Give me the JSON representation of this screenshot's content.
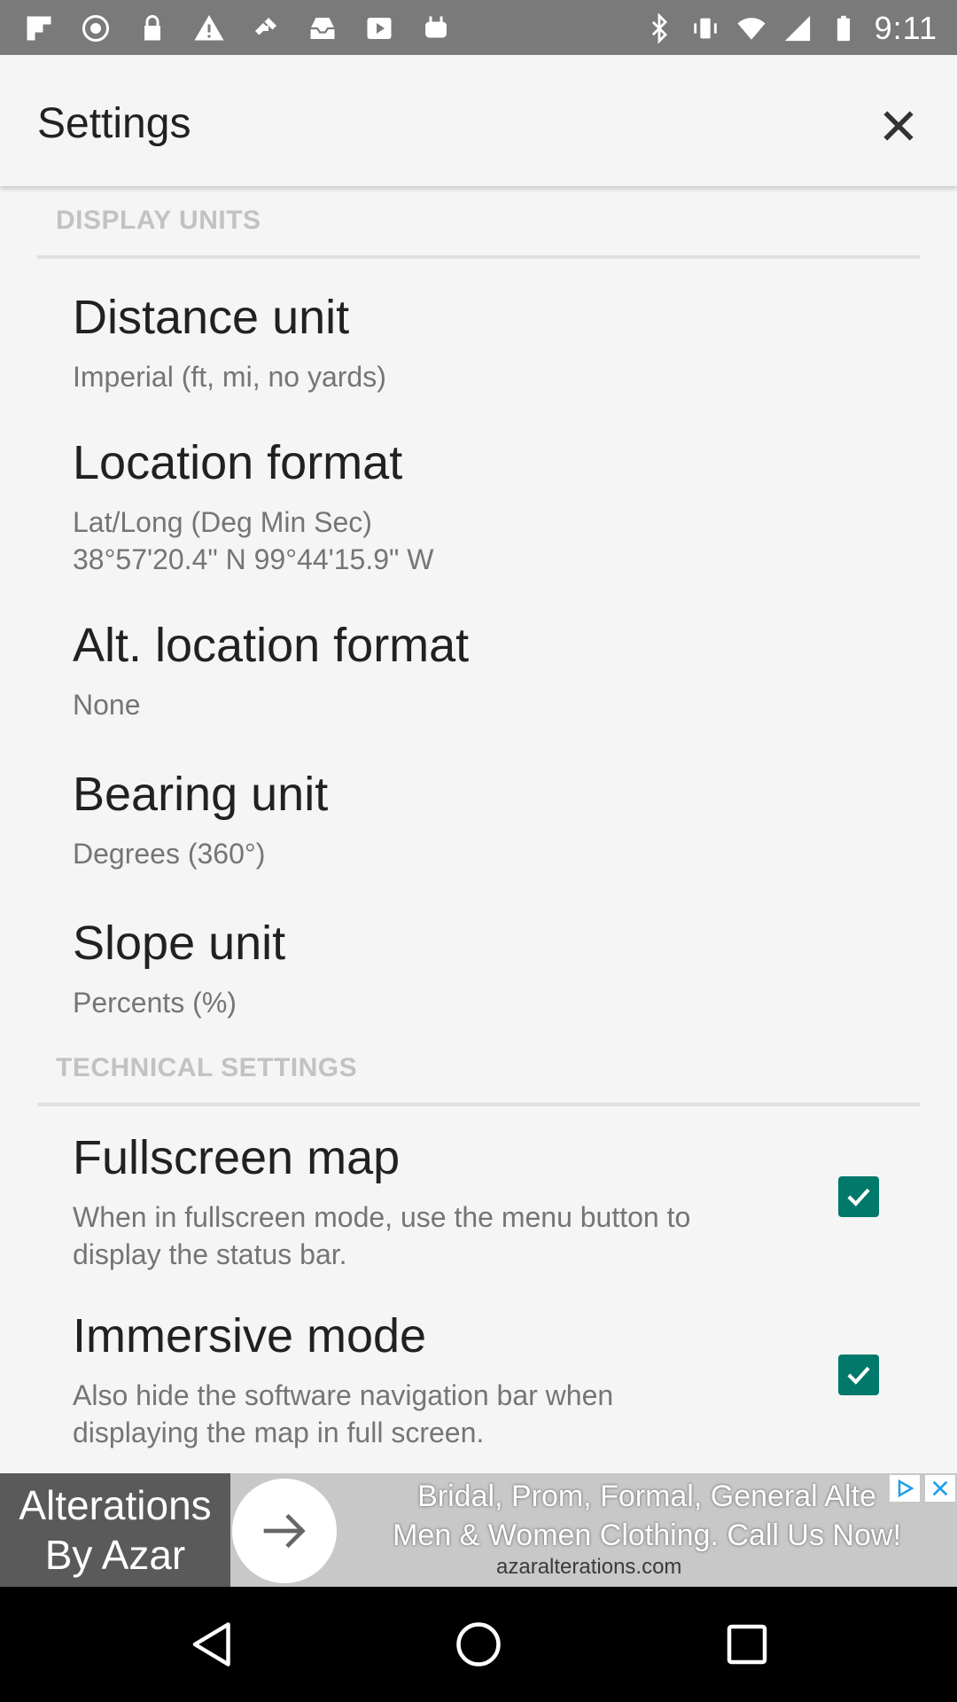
{
  "status_bar": {
    "time": "9:11",
    "left_icons": [
      "flipboard-icon",
      "pocket-icon",
      "lock-icon",
      "warning-icon",
      "fake-gps-icon",
      "inbox-icon",
      "video-icon",
      "android-icon"
    ],
    "right_icons": [
      "bluetooth-icon",
      "vibrate-icon",
      "wifi-icon",
      "signal-icon",
      "battery-icon"
    ]
  },
  "app_bar": {
    "title": "Settings"
  },
  "sections": [
    {
      "header": "DISPLAY UNITS",
      "items": [
        {
          "title": "Distance unit",
          "summary": [
            "Imperial (ft, mi, no yards)"
          ]
        },
        {
          "title": "Location format",
          "summary": [
            "Lat/Long (Deg Min Sec)",
            "38°57'20.4\" N 99°44'15.9\" W"
          ]
        },
        {
          "title": "Alt. location format",
          "summary": [
            "None"
          ]
        },
        {
          "title": "Bearing unit",
          "summary": [
            "Degrees (360°)"
          ]
        },
        {
          "title": "Slope unit",
          "summary": [
            "Percents (%)"
          ]
        }
      ]
    },
    {
      "header": "TECHNICAL SETTINGS",
      "items": [
        {
          "title": "Fullscreen map",
          "summary": [
            "When in fullscreen mode, use the menu button to",
            "display the status bar."
          ],
          "checked": true
        },
        {
          "title": "Immersive mode",
          "summary": [
            "Also hide the software navigation bar when",
            "displaying the map in full screen."
          ],
          "checked": true
        }
      ]
    }
  ],
  "ad": {
    "brand": [
      "Alterations",
      "By Azar"
    ],
    "text": [
      "Bridal, Prom, Formal, General Alte",
      "Men & Women Clothing. Call Us Now!"
    ],
    "url": "azaralterations.com"
  },
  "colors": {
    "accent": "#00796b",
    "status_bar": "#7a7a7a",
    "background": "#f5f5f5"
  }
}
